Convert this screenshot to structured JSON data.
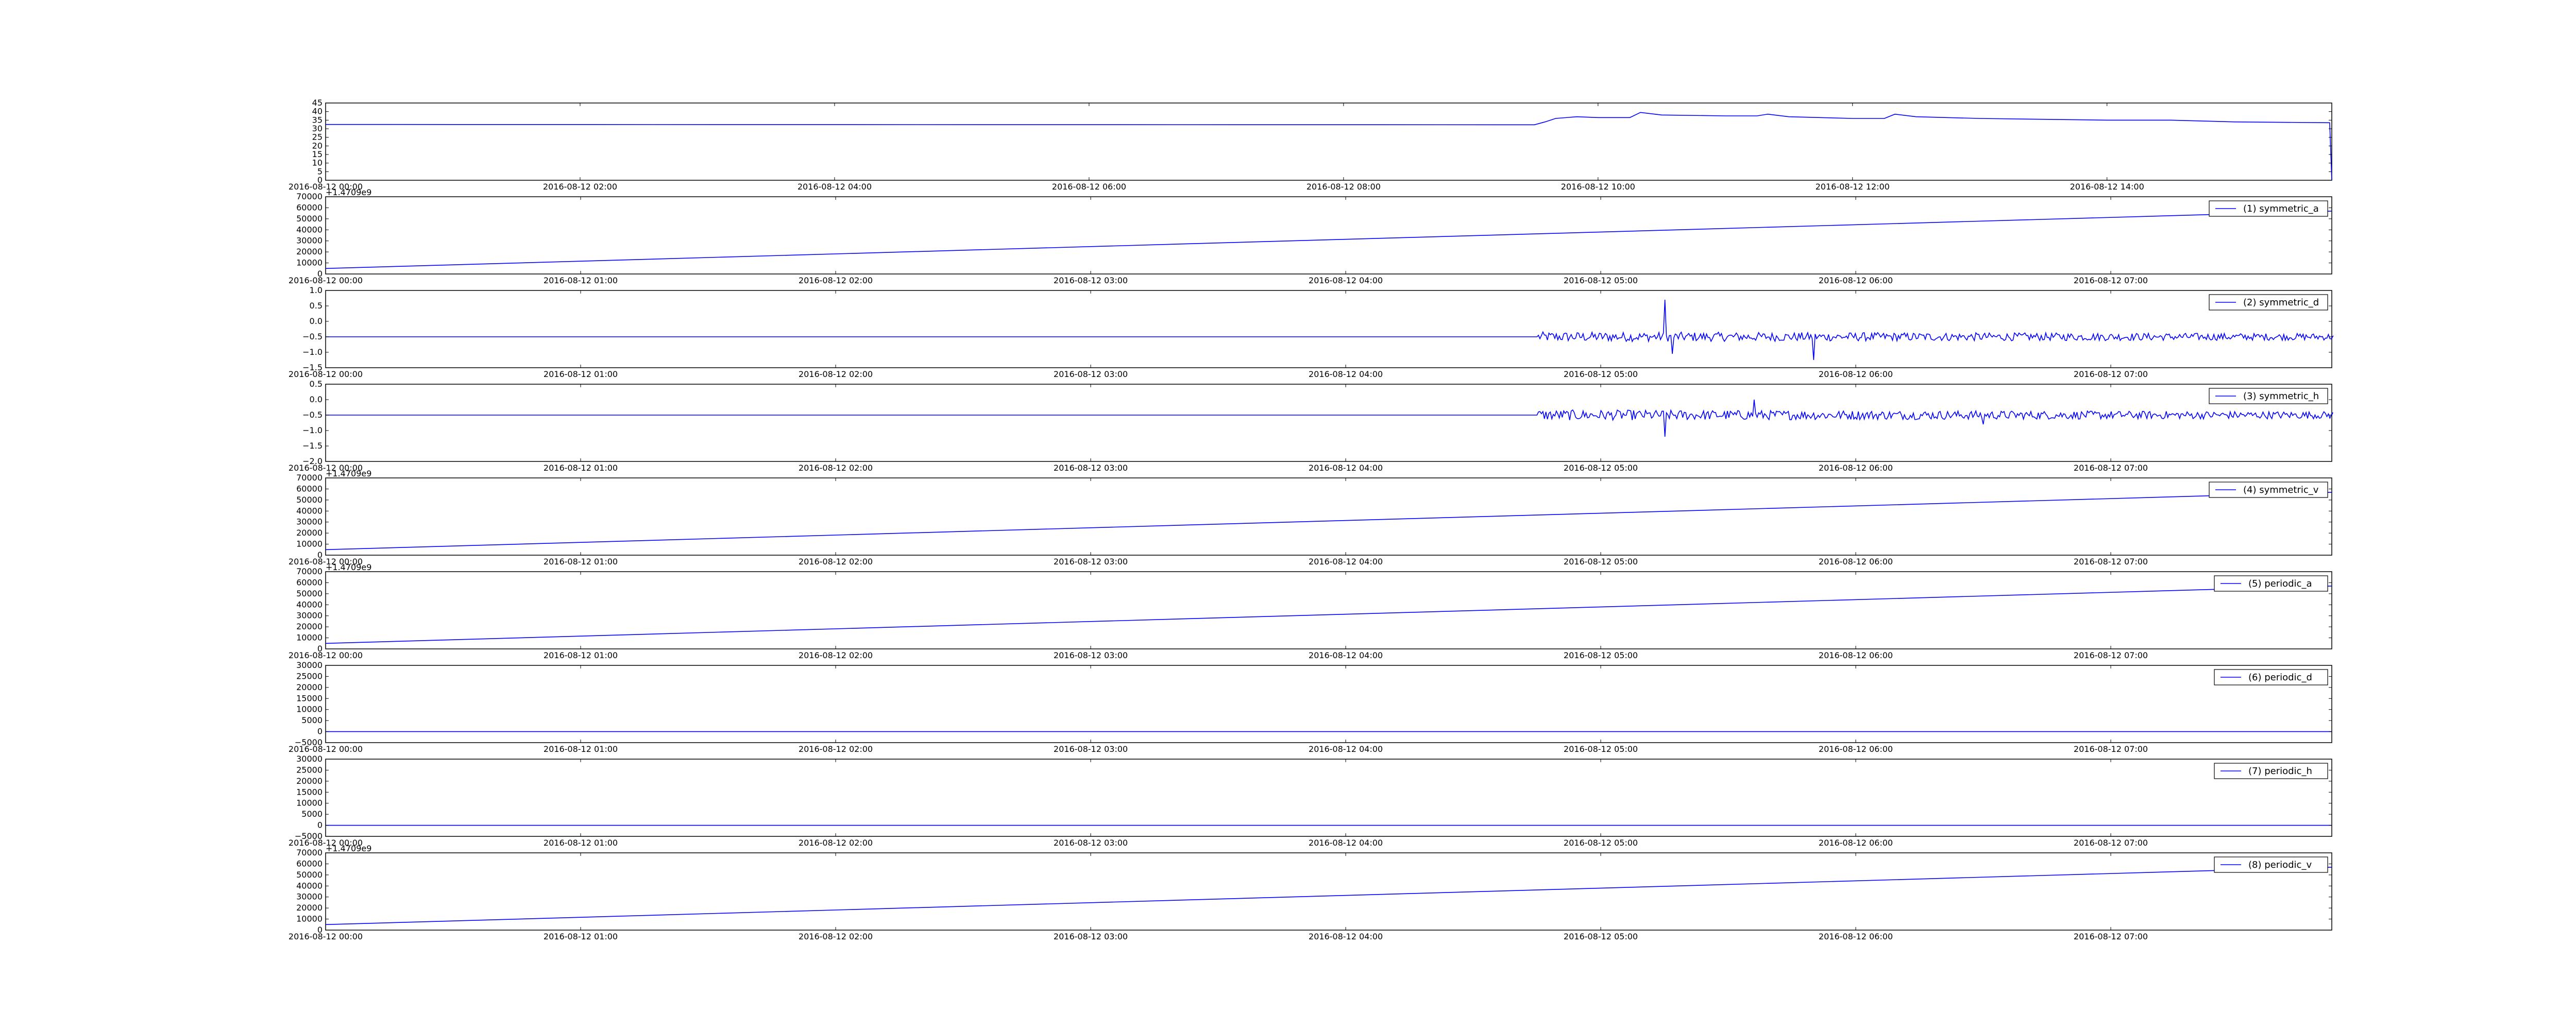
{
  "chart_data": [
    {
      "type": "line",
      "id": "panel-0",
      "x": [
        "2016-08-12 00:00",
        "2016-08-12 09:30",
        "2016-08-12 09:35",
        "2016-08-12 09:40",
        "2016-08-12 09:50",
        "2016-08-12 10:00",
        "2016-08-12 10:15",
        "2016-08-12 10:20",
        "2016-08-12 10:30",
        "2016-08-12 11:00",
        "2016-08-12 11:15",
        "2016-08-12 11:20",
        "2016-08-12 11:30",
        "2016-08-12 12:00",
        "2016-08-12 12:15",
        "2016-08-12 12:20",
        "2016-08-12 12:30",
        "2016-08-12 13:00",
        "2016-08-12 13:30",
        "2016-08-12 14:00",
        "2016-08-12 14:30",
        "2016-08-12 15:00",
        "2016-08-12 15:45",
        "2016-08-12 15:46"
      ],
      "values": [
        32.5,
        32.3,
        34,
        36,
        37,
        36.5,
        36.5,
        39.5,
        38,
        37.5,
        37.5,
        38.5,
        37,
        36,
        36,
        38.5,
        37,
        36,
        35.5,
        35,
        35,
        34,
        33.5,
        0
      ],
      "ylim": [
        0,
        45
      ],
      "yticks": [
        "0",
        "5",
        "10",
        "15",
        "20",
        "25",
        "30",
        "35",
        "40",
        "45"
      ],
      "xticks": [
        "2016-08-12 00:00",
        "2016-08-12 02:00",
        "2016-08-12 04:00",
        "2016-08-12 06:00",
        "2016-08-12 08:00",
        "2016-08-12 10:00",
        "2016-08-12 12:00",
        "2016-08-12 14:00"
      ],
      "offset_text": "",
      "legend": ""
    },
    {
      "type": "line",
      "id": "panel-1",
      "x": [
        "2016-08-12 00:00",
        "2016-08-12 07:52"
      ],
      "values": [
        5000,
        57000
      ],
      "ylim": [
        0,
        70000
      ],
      "yticks": [
        "0",
        "10000",
        "20000",
        "30000",
        "40000",
        "50000",
        "60000",
        "70000"
      ],
      "xticks": [
        "2016-08-12 00:00",
        "2016-08-12 01:00",
        "2016-08-12 02:00",
        "2016-08-12 03:00",
        "2016-08-12 04:00",
        "2016-08-12 05:00",
        "2016-08-12 06:00",
        "2016-08-12 07:00"
      ],
      "offset_text": "+1.4709e9",
      "legend": "(1) symmetric_a"
    },
    {
      "type": "line",
      "id": "panel-2",
      "x": [
        "2016-08-12 00:00",
        "2016-08-12 04:45",
        "2016-08-12 07:52"
      ],
      "values": [
        -0.5,
        -0.5,
        -0.5
      ],
      "noise": {
        "start": "2016-08-12 04:45",
        "base": -0.5,
        "amp": 0.16
      },
      "spikes": [
        {
          "x": "2016-08-12 05:15",
          "y": 0.7
        },
        {
          "x": "2016-08-12 05:17",
          "y": -1.05
        },
        {
          "x": "2016-08-12 05:50",
          "y": -1.25
        }
      ],
      "ylim": [
        -1.5,
        1.0
      ],
      "yticks": [
        "−1.5",
        "−1.0",
        "−0.5",
        "0.0",
        "0.5",
        "1.0"
      ],
      "xticks": [
        "2016-08-12 00:00",
        "2016-08-12 01:00",
        "2016-08-12 02:00",
        "2016-08-12 03:00",
        "2016-08-12 04:00",
        "2016-08-12 05:00",
        "2016-08-12 06:00",
        "2016-08-12 07:00"
      ],
      "offset_text": "",
      "legend": "(2) symmetric_d"
    },
    {
      "type": "line",
      "id": "panel-3",
      "x": [
        "2016-08-12 00:00",
        "2016-08-12 04:45",
        "2016-08-12 07:52"
      ],
      "values": [
        -0.5,
        -0.5,
        -0.5
      ],
      "noise": {
        "start": "2016-08-12 04:45",
        "base": -0.5,
        "amp": 0.17
      },
      "spikes": [
        {
          "x": "2016-08-12 05:15",
          "y": -1.2
        },
        {
          "x": "2016-08-12 05:36",
          "y": 0.0
        },
        {
          "x": "2016-08-12 06:30",
          "y": -0.8
        }
      ],
      "ylim": [
        -2.0,
        0.5
      ],
      "yticks": [
        "−2.0",
        "−1.5",
        "−1.0",
        "−0.5",
        "0.0",
        "0.5"
      ],
      "xticks": [
        "2016-08-12 00:00",
        "2016-08-12 01:00",
        "2016-08-12 02:00",
        "2016-08-12 03:00",
        "2016-08-12 04:00",
        "2016-08-12 05:00",
        "2016-08-12 06:00",
        "2016-08-12 07:00"
      ],
      "offset_text": "",
      "legend": "(3) symmetric_h"
    },
    {
      "type": "line",
      "id": "panel-4",
      "x": [
        "2016-08-12 00:00",
        "2016-08-12 07:52"
      ],
      "values": [
        5000,
        57000
      ],
      "ylim": [
        0,
        70000
      ],
      "yticks": [
        "0",
        "10000",
        "20000",
        "30000",
        "40000",
        "50000",
        "60000",
        "70000"
      ],
      "xticks": [
        "2016-08-12 00:00",
        "2016-08-12 01:00",
        "2016-08-12 02:00",
        "2016-08-12 03:00",
        "2016-08-12 04:00",
        "2016-08-12 05:00",
        "2016-08-12 06:00",
        "2016-08-12 07:00"
      ],
      "offset_text": "+1.4709e9",
      "legend": "(4) symmetric_v"
    },
    {
      "type": "line",
      "id": "panel-5",
      "x": [
        "2016-08-12 00:00",
        "2016-08-12 07:52"
      ],
      "values": [
        5000,
        57000
      ],
      "ylim": [
        0,
        70000
      ],
      "yticks": [
        "0",
        "10000",
        "20000",
        "30000",
        "40000",
        "50000",
        "60000",
        "70000"
      ],
      "xticks": [
        "2016-08-12 00:00",
        "2016-08-12 01:00",
        "2016-08-12 02:00",
        "2016-08-12 03:00",
        "2016-08-12 04:00",
        "2016-08-12 05:00",
        "2016-08-12 06:00",
        "2016-08-12 07:00"
      ],
      "offset_text": "+1.4709e9",
      "legend": "(5) periodic_a"
    },
    {
      "type": "line",
      "id": "panel-6",
      "x": [
        "2016-08-12 00:00",
        "2016-08-12 07:52"
      ],
      "values": [
        0,
        0
      ],
      "ylim": [
        -5000,
        30000
      ],
      "yticks": [
        "−5000",
        "0",
        "5000",
        "10000",
        "15000",
        "20000",
        "25000",
        "30000"
      ],
      "xticks": [
        "2016-08-12 00:00",
        "2016-08-12 01:00",
        "2016-08-12 02:00",
        "2016-08-12 03:00",
        "2016-08-12 04:00",
        "2016-08-12 05:00",
        "2016-08-12 06:00",
        "2016-08-12 07:00"
      ],
      "offset_text": "",
      "legend": "(6) periodic_d"
    },
    {
      "type": "line",
      "id": "panel-7",
      "x": [
        "2016-08-12 00:00",
        "2016-08-12 07:52"
      ],
      "values": [
        0,
        0
      ],
      "ylim": [
        -5000,
        30000
      ],
      "yticks": [
        "−5000",
        "0",
        "5000",
        "10000",
        "15000",
        "20000",
        "25000",
        "30000"
      ],
      "xticks": [
        "2016-08-12 00:00",
        "2016-08-12 01:00",
        "2016-08-12 02:00",
        "2016-08-12 03:00",
        "2016-08-12 04:00",
        "2016-08-12 05:00",
        "2016-08-12 06:00",
        "2016-08-12 07:00"
      ],
      "offset_text": "",
      "legend": "(7) periodic_h"
    },
    {
      "type": "line",
      "id": "panel-8",
      "x": [
        "2016-08-12 00:00",
        "2016-08-12 07:52"
      ],
      "values": [
        5000,
        57000
      ],
      "ylim": [
        0,
        70000
      ],
      "yticks": [
        "0",
        "10000",
        "20000",
        "30000",
        "40000",
        "50000",
        "60000",
        "70000"
      ],
      "xticks": [
        "2016-08-12 00:00",
        "2016-08-12 01:00",
        "2016-08-12 02:00",
        "2016-08-12 03:00",
        "2016-08-12 04:00",
        "2016-08-12 05:00",
        "2016-08-12 06:00",
        "2016-08-12 07:00"
      ],
      "offset_text": "+1.4709e9",
      "legend": "(8) periodic_v"
    }
  ],
  "colors": {
    "line": "#0000ff",
    "axes": "#000000",
    "background": "#ffffff"
  },
  "grid": false
}
